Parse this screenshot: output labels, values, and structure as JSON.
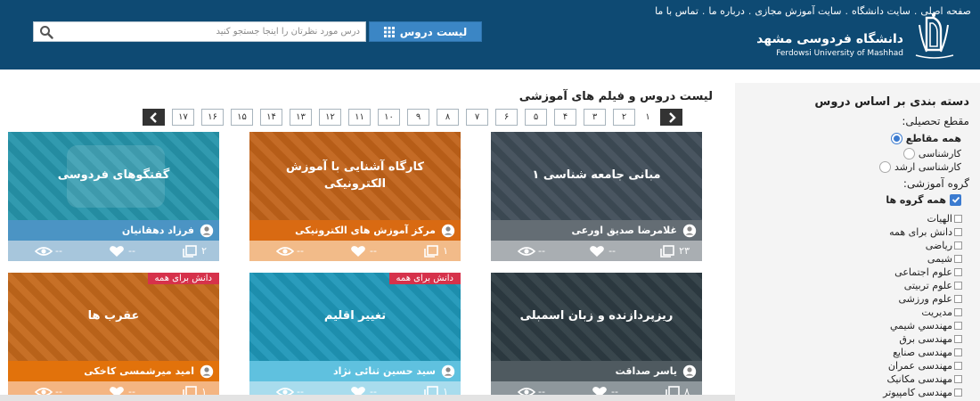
{
  "header": {
    "top_links": [
      "صفحه اصلی",
      "سایت دانشگاه",
      "سایت آموزش مجازی",
      "درباره ما",
      "تماس با ما"
    ],
    "top_links_separator": ".",
    "search": {
      "placeholder": "درس مورد نظرتان را اینجا جستجو کنید",
      "value": ""
    },
    "course_list_button": "لیست دروس",
    "university_name_fa": "دانشگاه فردوسی مشهد",
    "university_name_en": "Ferdowsi University of Mashhad",
    "colors": {
      "header_bg": "#0e4a73",
      "button_bg": "#3b86c5"
    }
  },
  "main": {
    "title": "لیست دروس و فیلم های آموزشی",
    "pagination": {
      "current": "۱",
      "pages": [
        "۲",
        "۳",
        "۴",
        "۵",
        "۶",
        "۷",
        "۸",
        "۹",
        "۱۰",
        "۱۱",
        "۱۲",
        "۱۳",
        "۱۴",
        "۱۵",
        "۱۶",
        "۱۷"
      ],
      "next_icon": "chevron-left-icon",
      "prev_icon": "chevron-right-icon"
    },
    "cards": [
      {
        "title": "مبانی جامعه شناسی ۱",
        "teacher": "غلامرضا صدیق اورعی",
        "episodes": "۲۳",
        "likes": "--",
        "views": "--",
        "badge": "",
        "thumb_color": "#3f4c57",
        "bar_color": "#646d74",
        "stats_color": "#a9aeb2"
      },
      {
        "title": "کارگاه آشنایی با آموزش الکترونیکی",
        "teacher": "مرکز آموزش های الکترونیکی",
        "episodes": "۱",
        "likes": "--",
        "views": "--",
        "badge": "",
        "thumb_color": "#c1631a",
        "bar_color": "#d96a12",
        "stats_color": "#f2bb89"
      },
      {
        "title": "گفتگوهای فردوسی",
        "teacher": "فرزاد دهقانیان",
        "episodes": "۲",
        "likes": "--",
        "views": "--",
        "badge": "",
        "thumb_color": "#2695ab",
        "bar_color": "#4b94c4",
        "stats_color": "#a7c6dc"
      },
      {
        "title": "ریزپردازنده و زبان اسمبلی",
        "teacher": "یاسر صداقت",
        "episodes": "۸",
        "likes": "--",
        "views": "--",
        "badge": "",
        "thumb_color": "#2e3c43",
        "bar_color": "#4f5a60",
        "stats_color": "#8e979c"
      },
      {
        "title": "تغییر اقلیم",
        "teacher": "سید حسین ثنائی نژاد",
        "episodes": "۱",
        "likes": "--",
        "views": "--",
        "badge": "دانش برای همه",
        "thumb_color": "#1f97b8",
        "bar_color": "#5fc1df",
        "stats_color": "#a8dced"
      },
      {
        "title": "عقرب ها",
        "teacher": "امید میرشمسی کاخکی",
        "episodes": "۱",
        "likes": "--",
        "views": "--",
        "badge": "دانش برای همه",
        "thumb_color": "#c4681b",
        "bar_color": "#e2720b",
        "stats_color": "#f4b582"
      }
    ]
  },
  "sidebar": {
    "title": "دسته بندی بر اساس دروس",
    "level_label": "مقطع تحصیلی:",
    "levels": [
      {
        "label": "همه مقاطع",
        "checked": true
      },
      {
        "label": "کارشناسی",
        "checked": false
      },
      {
        "label": "کارشناسی ارشد",
        "checked": false
      }
    ],
    "group_label": "گروه آموزشی:",
    "all_groups": "همه گروه ها",
    "groups": [
      "الهیات",
      "دانش برای همه",
      "ریاضی",
      "شیمی",
      "علوم اجتماعی",
      "علوم تربیتی",
      "علوم ورزشی",
      "مدیریت",
      "مهندسي شيمي",
      "مهندسی برق",
      "مهندسی صنایع",
      "مهندسی عمران",
      "مهندسی مکانیک",
      "مهندسی کامپیوتر"
    ]
  }
}
